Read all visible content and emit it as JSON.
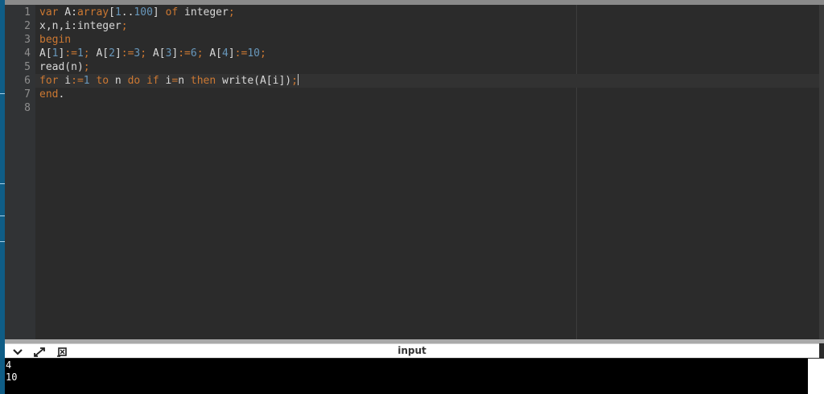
{
  "editor": {
    "line_numbers": [
      "1",
      "2",
      "3",
      "4",
      "5",
      "6",
      "7",
      "8"
    ],
    "lines": [
      [
        [
          "kw",
          "var"
        ],
        [
          "id",
          " A:"
        ],
        [
          "kw",
          "array"
        ],
        [
          "id",
          "["
        ],
        [
          "num",
          "1"
        ],
        [
          "id",
          ".."
        ],
        [
          "num",
          "100"
        ],
        [
          "id",
          "] "
        ],
        [
          "kw",
          "of"
        ],
        [
          "id",
          " integer"
        ],
        [
          "op",
          ";"
        ]
      ],
      [
        [
          "id",
          "x,n,i:integer"
        ],
        [
          "op",
          ";"
        ]
      ],
      [
        [
          "kw",
          "begin"
        ]
      ],
      [
        [
          "id",
          "A["
        ],
        [
          "num",
          "1"
        ],
        [
          "id",
          "]"
        ],
        [
          "op",
          ":="
        ],
        [
          "num",
          "1"
        ],
        [
          "op",
          ";"
        ],
        [
          "id",
          " A["
        ],
        [
          "num",
          "2"
        ],
        [
          "id",
          "]"
        ],
        [
          "op",
          ":="
        ],
        [
          "num",
          "3"
        ],
        [
          "op",
          ";"
        ],
        [
          "id",
          " A["
        ],
        [
          "num",
          "3"
        ],
        [
          "id",
          "]"
        ],
        [
          "op",
          ":="
        ],
        [
          "num",
          "6"
        ],
        [
          "op",
          ";"
        ],
        [
          "id",
          " A["
        ],
        [
          "num",
          "4"
        ],
        [
          "id",
          "]"
        ],
        [
          "op",
          ":="
        ],
        [
          "num",
          "10"
        ],
        [
          "op",
          ";"
        ]
      ],
      [
        [
          "id",
          "read(n)"
        ],
        [
          "op",
          ";"
        ]
      ],
      [
        [
          "kw",
          "for"
        ],
        [
          "id",
          " i"
        ],
        [
          "op",
          ":="
        ],
        [
          "num",
          "1"
        ],
        [
          "id",
          " "
        ],
        [
          "kw",
          "to"
        ],
        [
          "id",
          " n "
        ],
        [
          "kw",
          "do"
        ],
        [
          "id",
          " "
        ],
        [
          "kw",
          "if"
        ],
        [
          "id",
          " i"
        ],
        [
          "op",
          "="
        ],
        [
          "id",
          "n "
        ],
        [
          "kw",
          "then"
        ],
        [
          "id",
          " write(A[i])"
        ],
        [
          "op",
          ";"
        ]
      ],
      [
        [
          "kw",
          "end"
        ],
        [
          "id",
          "."
        ]
      ],
      []
    ],
    "active_line": 6,
    "colors": {
      "keyword": "#cc7832",
      "number": "#6897bb",
      "identifier": "#d8d8d8",
      "background": "#2b2b2b"
    }
  },
  "panel": {
    "title": "input",
    "icons": [
      "chevron-down-icon",
      "expand-icon",
      "clear-input-icon"
    ],
    "lines": [
      "4",
      "10"
    ]
  }
}
